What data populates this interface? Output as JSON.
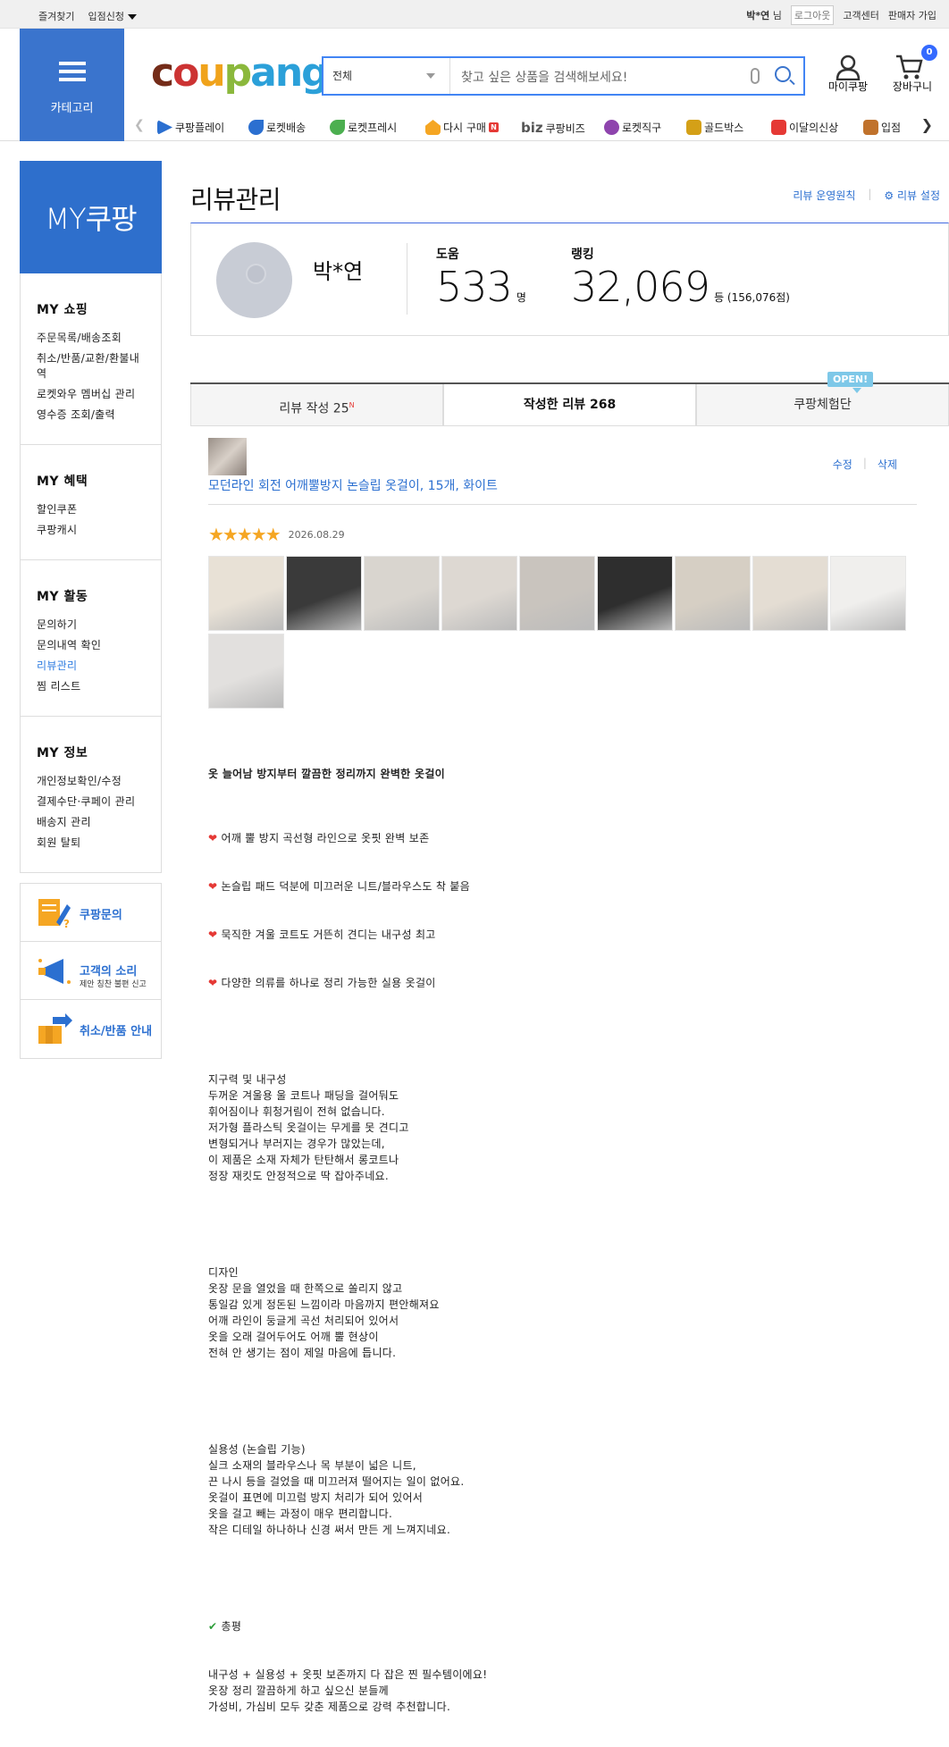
{
  "topbar": {
    "favorites": "즐겨찾기",
    "vendor_apply": "입점신청",
    "user_name": "박*연",
    "user_suffix": "님",
    "logout": "로그아웃",
    "customer_center": "고객센터",
    "seller_join": "판매자 가입"
  },
  "header": {
    "category": "카테고리",
    "logo": [
      "c",
      "o",
      "u",
      "p",
      "ang"
    ],
    "search_select": "전체",
    "search_placeholder": "찾고 싶은 상품을 검색해보세요!",
    "mycoupang": "마이쿠팡",
    "cart": "장바구니",
    "cart_count": "0"
  },
  "gnb": [
    {
      "label": "쿠팡플레이",
      "color": "#2b6fd0"
    },
    {
      "label": "로켓배송",
      "color": "#2b6fd0"
    },
    {
      "label": "로켓프레시",
      "color": "#4caf50"
    },
    {
      "label": "다시 구매",
      "color": "#f5a623",
      "badge": "N"
    },
    {
      "label": "쿠팡비즈",
      "color": "#555",
      "prefix": "biz"
    },
    {
      "label": "로켓직구",
      "color": "#8e44ad"
    },
    {
      "label": "골드박스",
      "color": "#d4a017"
    },
    {
      "label": "이달의신상",
      "color": "#e53935"
    },
    {
      "label": "입점",
      "color": "#c0722c"
    }
  ],
  "sidebar": {
    "my_title": "MY쿠팡",
    "groups": [
      {
        "title": "MY 쇼핑",
        "items": [
          "주문목록/배송조회",
          "취소/반품/교환/환불내역",
          "로켓와우 멤버십 관리",
          "영수증 조회/출력"
        ]
      },
      {
        "title": "MY 혜택",
        "items": [
          "할인쿠폰",
          "쿠팡캐시"
        ]
      },
      {
        "title": "MY 활동",
        "items": [
          "문의하기",
          "문의내역 확인",
          "리뷰관리",
          "찜 리스트"
        ]
      },
      {
        "title": "MY 정보",
        "items": [
          "개인정보확인/수정",
          "결제수단·쿠페이 관리",
          "배송지 관리",
          "회원 탈퇴"
        ]
      }
    ],
    "banners": [
      {
        "title": "쿠팡문의",
        "sub": ""
      },
      {
        "title": "고객의 소리",
        "sub": "제안 칭찬 불편 신고"
      },
      {
        "title": "취소/반품 안내",
        "sub": ""
      }
    ]
  },
  "page": {
    "title": "리뷰관리",
    "policy_link": "리뷰 운영원칙",
    "settings_link": "리뷰 설정"
  },
  "profile": {
    "name": "박*연",
    "help_label": "도움",
    "help_value": "533",
    "help_unit": "명",
    "rank_label": "랭킹",
    "rank_value": "32,069",
    "rank_unit": "등 (156,076점)"
  },
  "tabs": {
    "write": "리뷰 작성 25",
    "write_badge": "N",
    "written": "작성한 리뷰 268",
    "experience": "쿠팡체험단",
    "open_badge": "OPEN!"
  },
  "review": {
    "product_name": "모던라인 회전 어깨뿔방지 논슬립 옷걸이, 15개, 화이트",
    "edit": "수정",
    "delete": "삭제",
    "stars": "★★★★★",
    "date": "2026.08.29",
    "title": "옷 늘어남 방지부터 깔끔한 정리까지 완벽한 옷걸이",
    "hearts": [
      "어깨 뿔 방지 곡선형 라인으로 옷핏 완벽 보존",
      "논슬립 패드 덕분에 미끄러운 니트/블라우스도 착 붙음",
      "묵직한 겨울 코트도 거뜬히 견디는 내구성 최고",
      "다양한 의류를 하나로 정리 가능한 실용 옷걸이"
    ],
    "para1": "지구력 및 내구성\n두꺼운 겨울용 울 코트나 패딩을 걸어둬도\n휘어짐이나 휘청거림이 전혀 없습니다.\n저가형 플라스틱 옷걸이는 무게를 못 견디고\n변형되거나 부러지는 경우가 많았는데,\n이 제품은 소재 자체가 탄탄해서 롱코트나\n정장 재킷도 안정적으로 딱 잡아주네요.",
    "para2": "디자인\n옷장 문을 열었을 때 한쪽으로 쏠리지 않고\n통일감 있게 정돈된 느낌이라 마음까지 편안해져요\n어깨 라인이 둥글게 곡선 처리되어 있어서\n옷을 오래 걸어두어도 어깨 뿔 현상이\n전혀 안 생기는 점이 제일 마음에 듭니다.",
    "para3": "실용성 (논슬립 기능)\n실크 소재의 블라우스나 목 부분이 넓은 니트,\n끈 나시 등을 걸었을 때 미끄러져 떨어지는 일이 없어요.\n옷걸이 표면에 미끄럼 방지 처리가 되어 있어서\n옷을 걸고 빼는 과정이 매우 편리합니다.\n작은 디테일 하나하나 신경 써서 만든 게 느껴지네요.",
    "summary_label": "총평",
    "para4": "내구성 + 실용성 + 옷핏 보존까지 다 잡은 찐 필수템이에요!\n옷장 정리 깔끔하게 하고 싶으신 분들께\n가성비, 가심비 모두 갖춘 제품으로 강력 추천합니다."
  },
  "photo_colors": [
    "#e8e1d6",
    "#3a3a3a",
    "#d9d5cf",
    "#ddd8d2",
    "#c9c4be",
    "#2e2e2e",
    "#d6cfc4",
    "#e4ddd3",
    "#f0efed",
    "#e2e0de",
    "#cfccc5",
    "#eeeeec",
    "#4a4a4a"
  ]
}
